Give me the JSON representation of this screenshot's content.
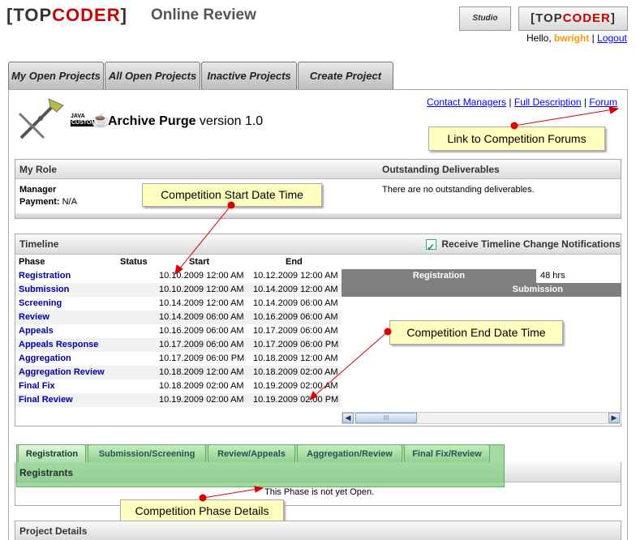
{
  "header": {
    "logo_left": "[",
    "logo_top": "TOP",
    "logo_coder": "CODER",
    "logo_right": "]",
    "title": "Online Review",
    "studio_button": "Studio",
    "tc_button_top": "TOP",
    "tc_button_coder": "CODER",
    "greeting": "Hello, ",
    "username": "bwright",
    "separator": " | ",
    "logout": "Logout"
  },
  "tabs": [
    {
      "label": "My Open Projects"
    },
    {
      "label": "All Open Projects"
    },
    {
      "label": "Inactive Projects"
    },
    {
      "label": "Create Project"
    }
  ],
  "project": {
    "name": "Archive Purge",
    "version": " version 1.0",
    "java_badge_1": "JAVA",
    "java_badge_2": "CUSTOM",
    "links": {
      "contact": "Contact Managers",
      "description": "Full Description",
      "forum": "Forum",
      "sep": " | "
    }
  },
  "callouts": {
    "forum": "Link to Competition Forums",
    "start": "Competition Start Date Time",
    "end": "Competition End Date Time",
    "phase": "Competition Phase Details"
  },
  "my_role": {
    "title": "My Role",
    "outstanding_title": "Outstanding Deliverables",
    "role": "Manager",
    "payment_label": "Payment:",
    "payment_value": " N/A",
    "deliverables": "There are no outstanding deliverables."
  },
  "timeline": {
    "title": "Timeline",
    "notify_label": "Receive Timeline Change Notifications",
    "columns": {
      "phase": "Phase",
      "status": "Status",
      "start": "Start",
      "end": "End"
    },
    "rows": [
      {
        "phase": "Registration",
        "start": "10.10.2009 12:00 AM",
        "end": "10.12.2009 12:00 AM"
      },
      {
        "phase": "Submission",
        "start": "10.10.2009 12:00 AM",
        "end": "10.14.2009 12:00 AM"
      },
      {
        "phase": "Screening",
        "start": "10.14.2009 12:00 AM",
        "end": "10.14.2009 06:00 AM"
      },
      {
        "phase": "Review",
        "start": "10.14.2009 06:00 AM",
        "end": "10.16.2009 06:00 AM"
      },
      {
        "phase": "Appeals",
        "start": "10.16.2009 06:00 AM",
        "end": "10.17.2009 06:00 AM"
      },
      {
        "phase": "Appeals Response",
        "start": "10.17.2009 06:00 AM",
        "end": "10.17.2009 06:00 PM"
      },
      {
        "phase": "Aggregation",
        "start": "10.17.2009 06:00 PM",
        "end": "10.18.2009 12:00 AM"
      },
      {
        "phase": "Aggregation Review",
        "start": "10.18.2009 12:00 AM",
        "end": "10.18.2009 02:00 AM"
      },
      {
        "phase": "Final Fix",
        "start": "10.18.2009 02:00 AM",
        "end": "10.19.2009 02:00 AM"
      },
      {
        "phase": "Final Review",
        "start": "10.19.2009 02:00 AM",
        "end": "10.19.2009 02:00 PM"
      }
    ],
    "gantt": {
      "registration_label": "Registration",
      "registration_hours": "48 hrs",
      "submission_label": "Submission"
    },
    "scroll_thumb": "III"
  },
  "phase_tabs": [
    {
      "label": "Registration"
    },
    {
      "label": "Submission/Screening"
    },
    {
      "label": "Review/Appeals"
    },
    {
      "label": "Aggregation/Review"
    },
    {
      "label": "Final Fix/Review"
    }
  ],
  "registrants": {
    "title": "Registrants",
    "message": "This Phase is not yet Open."
  },
  "project_details": {
    "title": "Project Details"
  }
}
